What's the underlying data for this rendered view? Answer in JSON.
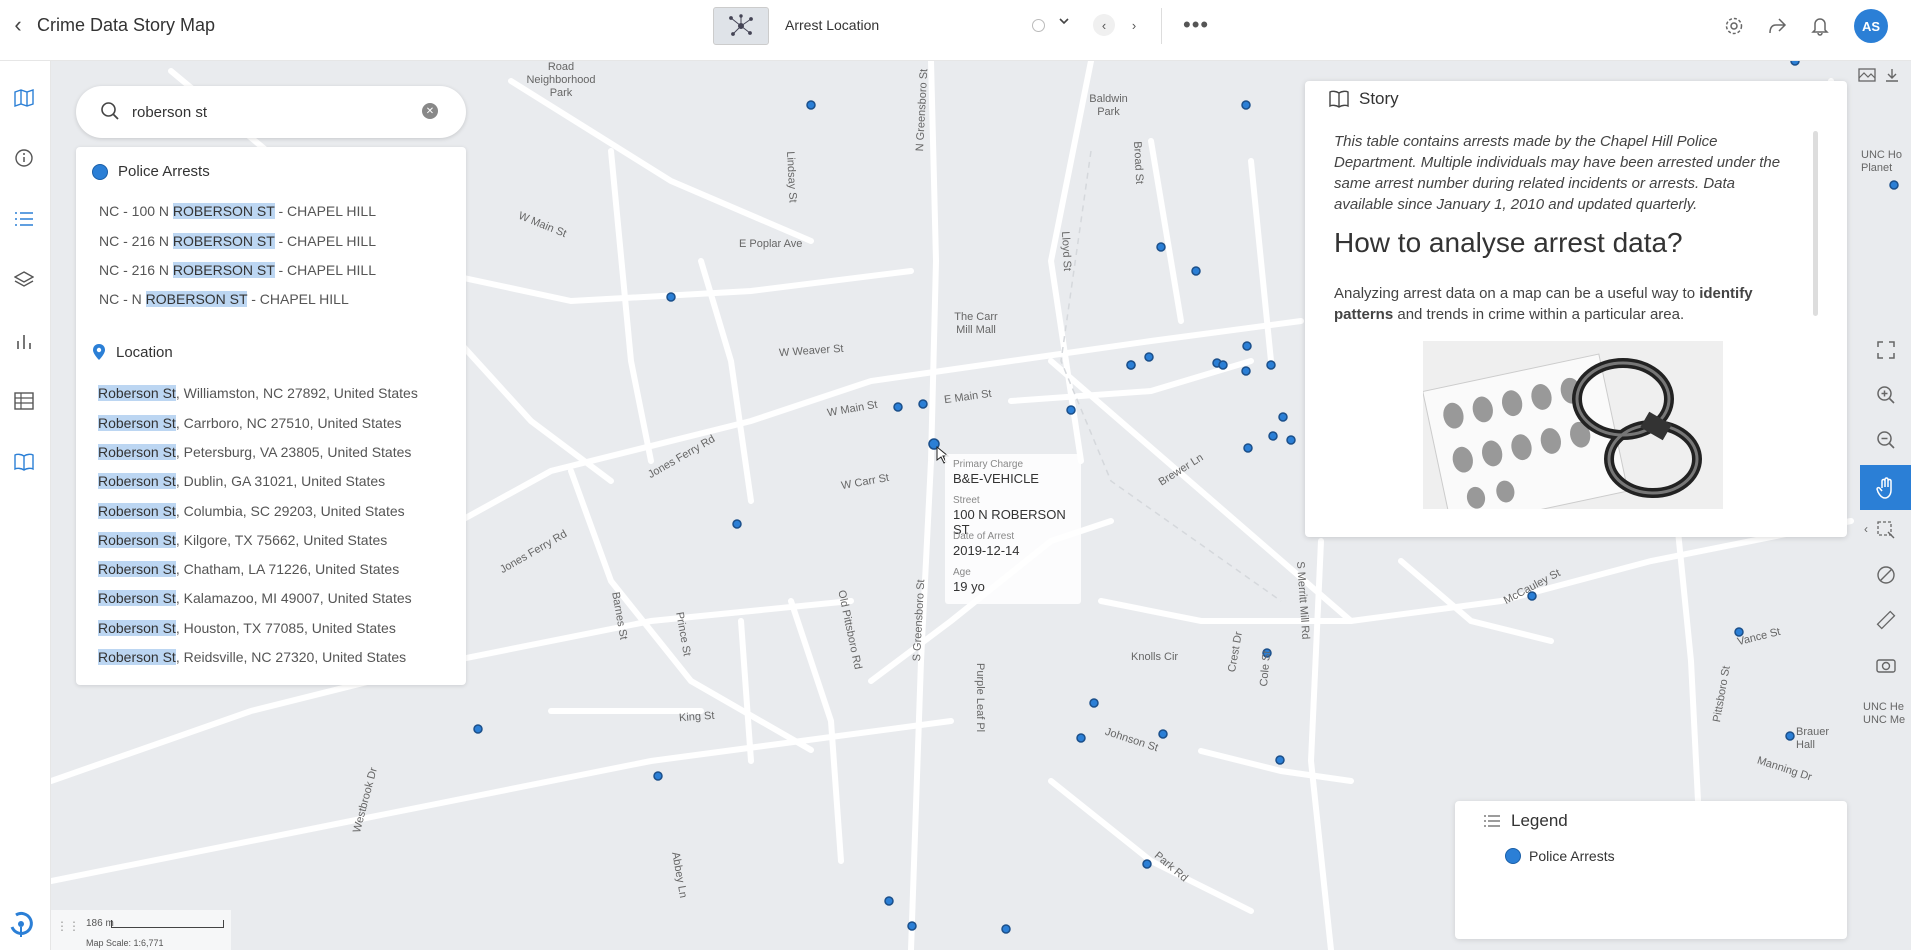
{
  "app": {
    "title": "Crime Data Story Map",
    "avatar_initials": "AS"
  },
  "layer": {
    "name": "Arrest Location"
  },
  "search": {
    "value": "roberson st",
    "groups": [
      {
        "title": "Police Arrests",
        "items": [
          {
            "pre": "NC - 100 N ",
            "hl": "ROBERSON ST",
            "post": " - CHAPEL HILL"
          },
          {
            "pre": "NC - 216 N ",
            "hl": "ROBERSON ST",
            "post": " - CHAPEL HILL"
          },
          {
            "pre": "NC - 216 N ",
            "hl": "ROBERSON ST",
            "post": " - CHAPEL HILL"
          },
          {
            "pre": "NC - N ",
            "hl": "ROBERSON ST",
            "post": " - CHAPEL HILL"
          }
        ]
      },
      {
        "title": "Location",
        "items": [
          {
            "pre": "",
            "hl": "Roberson St",
            "post": ", Williamston, NC 27892, United States"
          },
          {
            "pre": "",
            "hl": "Roberson St",
            "post": ", Carrboro, NC 27510, United States"
          },
          {
            "pre": "",
            "hl": "Roberson St",
            "post": ", Petersburg, VA 23805, United States"
          },
          {
            "pre": "",
            "hl": "Roberson St",
            "post": ", Dublin, GA 31021, United States"
          },
          {
            "pre": "",
            "hl": "Roberson St",
            "post": ", Columbia, SC 29203, United States"
          },
          {
            "pre": "",
            "hl": "Roberson St",
            "post": ", Kilgore, TX 75662, United States"
          },
          {
            "pre": "",
            "hl": "Roberson St",
            "post": ", Chatham, LA 71226, United States"
          },
          {
            "pre": "",
            "hl": "Roberson St",
            "post": ", Kalamazoo, MI 49007, United States"
          },
          {
            "pre": "",
            "hl": "Roberson St",
            "post": ", Houston, TX 77085, United States"
          },
          {
            "pre": "",
            "hl": "Roberson St",
            "post": ", Reidsville, NC 27320, United States"
          }
        ]
      }
    ]
  },
  "story": {
    "title": "Story",
    "intro": "This table contains arrests made by the Chapel Hill Police Department. Multiple individuals may have been arrested under the same arrest number during related incidents or arrests. Data available since January 1, 2010 and updated quarterly.",
    "heading": "How to analyse arrest data?",
    "para_pre": "Analyzing arrest data on a map can be a useful way to ",
    "para_b1": "identify patterns",
    "para_mid": " and trends in crime within a particular area."
  },
  "tooltip": {
    "k1": "Primary Charge",
    "v1": "B&E-VEHICLE",
    "k2": "Street",
    "v2": "100 N ROBERSON ST",
    "k3": "Date of Arrest",
    "v3": "2019-12-14",
    "k4": "Age",
    "v4": "19 yo"
  },
  "legend": {
    "title": "Legend",
    "item": "Police Arrests",
    "color": "#2b7fd6"
  },
  "scale": {
    "distance": "186 m",
    "label": "Map Scale: 1:6,771"
  },
  "map_labels": {
    "road_neighborhood": "Road Neighborhood Park",
    "baldwin": "Baldwin Park",
    "carr_mill": "The Carr Mill Mall",
    "w_main": "W Main St",
    "e_main": "E Main St",
    "poplar": "E Poplar Ave",
    "weaver": "W Weaver St",
    "jones_ferry": "Jones Ferry Rd",
    "w_carr": "W Carr St",
    "knolls": "Knolls Cir",
    "king": "King St",
    "johnson": "Johnson St",
    "mccauley": "McCauley St",
    "brewer": "Brewer Ln",
    "greensboro": "N Greensboro St",
    "s_greensboro": "S Greensboro St",
    "merritt": "S Merritt Mill Rd",
    "pittsboro": "Pittsboro St",
    "old_pittsboro": "Old Pittsboro Rd",
    "purple_leaf": "Purple Leaf Pl",
    "park": "Park Rd",
    "vance": "Vance St",
    "brauer": "Brauer Hall",
    "unc": "UNC Ho Planet",
    "unc2": "UNC He UNC Me",
    "lindsay": "Lindsay St",
    "lloyd": "Lloyd St",
    "broad": "Broad St",
    "barnes": "Barnes St",
    "prince": "Prince St",
    "westbrook": "Westbrook Dr",
    "abbey": "Abbey Ln",
    "manning": "Manning Dr",
    "crest": "Crest Dr",
    "cole": "Cole St"
  }
}
